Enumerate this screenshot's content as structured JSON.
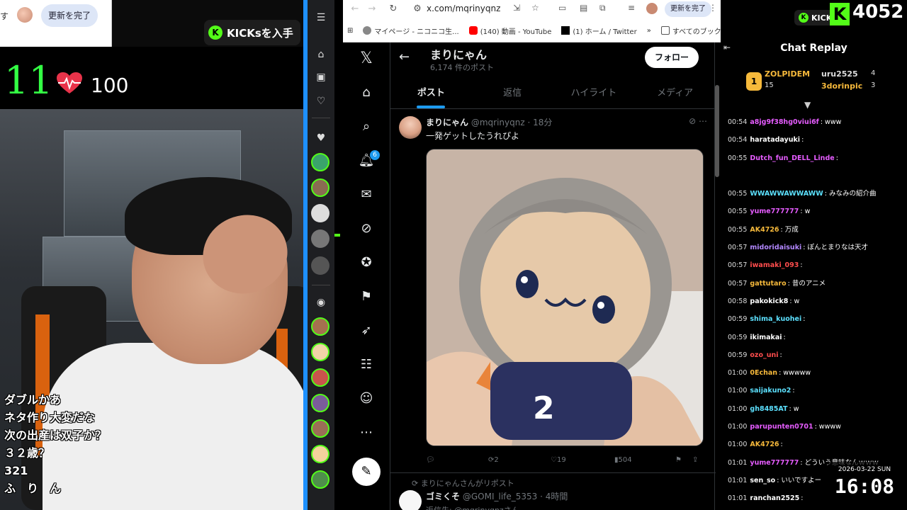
{
  "stream": {
    "mini_update_label": "更新を完了",
    "kicks_label": "KICKsを入手",
    "counter": "11",
    "heart_rate": "100",
    "overlay_lines": [
      "ダブルかあ",
      "ネタ作り大変だな",
      "次の出産は双子か？",
      "３２歳？",
      "321",
      "ふ　り　ん"
    ]
  },
  "chrome": {
    "url": "x.com/mqrinyqnz",
    "update_label": "更新を完了",
    "bookmarks": [
      "マイページ - ニコニコ生...",
      "(140) 動画 - YouTube",
      "(1) ホーム / Twitter",
      "すべてのブックマーク"
    ]
  },
  "profile": {
    "name": "まりにゃん",
    "post_count": "6,174 件のポスト",
    "follow_label": "フォロー",
    "tabs": [
      "ポスト",
      "返信",
      "ハイライト",
      "メディア"
    ],
    "notif_count": "6"
  },
  "tweet": {
    "name": "まりにゃん",
    "handle": "@mqrinyqnz · 18分",
    "text": "一発ゲットしたうれぴよ",
    "replies": "",
    "retweets": "2",
    "likes": "19",
    "views": "504"
  },
  "tweet2": {
    "rt_note": "まりにゃんさんがリポスト",
    "name": "ゴミくそ",
    "handle": "@GOMI_life_5353 · 4時間",
    "reply_to": "返信先: @mqrinyqnzさん"
  },
  "chat": {
    "kicks_label": "KICKs",
    "viewer_count": "4052",
    "title": "Chat Replay",
    "leaderboard": [
      {
        "user": "ZOLPIDEM",
        "score": "15"
      },
      {
        "user": "uru2525",
        "score": "4"
      },
      {
        "user": "3dorinpic",
        "score": "3"
      }
    ],
    "messages": [
      {
        "t": "00:54",
        "u": "a8jg9f38hg0viui6f",
        "m": ": www",
        "c": "#e65cff"
      },
      {
        "t": "00:54",
        "u": "haratadayuki",
        "m": ": ",
        "c": "#ffffff"
      },
      {
        "t": "00:55",
        "u": "Dutch_fun_DELL_Linde",
        "m": ": ",
        "c": "#e65cff"
      },
      {
        "t": "",
        "u": "",
        "m": "",
        "c": "#ffffff"
      },
      {
        "t": "00:55",
        "u": "WWAWWAWWAWW",
        "m": ": みなみの紹介曲",
        "c": "#5ce1ff"
      },
      {
        "t": "00:55",
        "u": "yume777777",
        "m": ": w",
        "c": "#e65cff"
      },
      {
        "t": "00:55",
        "u": "AK4726",
        "m": ": 万成",
        "c": "#f6b93b"
      },
      {
        "t": "00:57",
        "u": "midoridaisuki",
        "m": ": ぽんとまりなは天才",
        "c": "#b388ff"
      },
      {
        "t": "00:57",
        "u": "iwamaki_093",
        "m": ": ",
        "c": "#ff4d4d"
      },
      {
        "t": "00:57",
        "u": "gattutaro",
        "m": ": 昔のアニメ",
        "c": "#f6b93b"
      },
      {
        "t": "00:58",
        "u": "pakokick8",
        "m": ": w",
        "c": "#ffffff"
      },
      {
        "t": "00:59",
        "u": "shima_kuohei",
        "m": ": ",
        "c": "#5ce1ff"
      },
      {
        "t": "00:59",
        "u": "ikimakai",
        "m": ": ",
        "c": "#ffffff"
      },
      {
        "t": "00:59",
        "u": "ozo_uni",
        "m": ": ",
        "c": "#ff4d4d"
      },
      {
        "t": "01:00",
        "u": "0Echan",
        "m": ": wwwww",
        "c": "#f6b93b"
      },
      {
        "t": "01:00",
        "u": "saijakuno2",
        "m": ": ",
        "c": "#5ce1ff"
      },
      {
        "t": "01:00",
        "u": "gh8485AT",
        "m": ": w",
        "c": "#5ce1ff"
      },
      {
        "t": "01:00",
        "u": "parupunten0701",
        "m": ": wwww",
        "c": "#e65cff"
      },
      {
        "t": "01:00",
        "u": "AK4726",
        "m": ": ",
        "c": "#f6b93b"
      },
      {
        "t": "01:01",
        "u": "yume777777",
        "m": ": どういう意味なんｗｗｗ",
        "c": "#e65cff"
      },
      {
        "t": "01:01",
        "u": "sen_so",
        "m": ": いいですよー",
        "c": "#ffffff"
      },
      {
        "t": "01:01",
        "u": "ranchan2525",
        "m": ": ",
        "c": "#ffffff"
      }
    ]
  },
  "clock": {
    "date": "2026-03-22 SUN",
    "time": "16:08"
  }
}
